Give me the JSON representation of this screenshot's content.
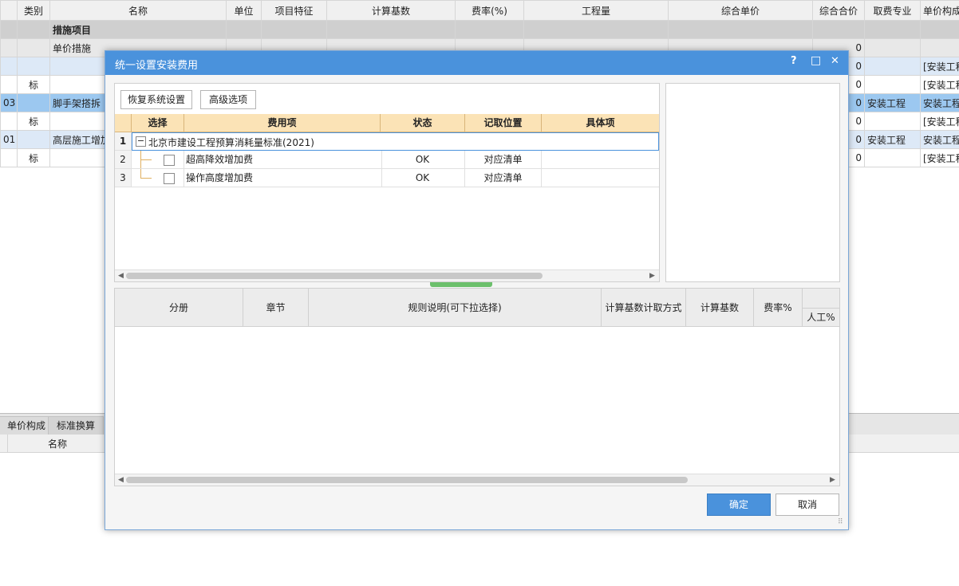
{
  "bg": {
    "headers": [
      "类别",
      "名称",
      "单位",
      "项目特征",
      "计算基数",
      "费率(%)",
      "工程量",
      "综合单价",
      "综合合价",
      "取费专业",
      "单价构成"
    ],
    "rows": [
      {
        "cls": "grp",
        "code": "",
        "type": "",
        "name": "措施项目",
        "total": "",
        "spec": "",
        "unit_comp": ""
      },
      {
        "cls": "sub",
        "code": "",
        "type": "",
        "name": "单价措施",
        "total": "0",
        "spec": "",
        "unit_comp": ""
      },
      {
        "cls": "lb",
        "code": "",
        "type": "",
        "name": "",
        "total": "0",
        "spec": "",
        "unit_comp": "[安装工程"
      },
      {
        "cls": "",
        "code": "",
        "type": "标",
        "name": "",
        "total": "0",
        "spec": "",
        "unit_comp": "[安装工程"
      },
      {
        "cls": "sel",
        "code": "03",
        "type": "",
        "name": "脚手架搭拆",
        "total": "0",
        "spec": "安装工程",
        "unit_comp": "安装工程"
      },
      {
        "cls": "",
        "code": "",
        "type": "标",
        "name": "",
        "total": "0",
        "spec": "",
        "unit_comp": "[安装工程"
      },
      {
        "cls": "lb",
        "code": "01",
        "type": "",
        "name": "高层施工增加",
        "total": "0",
        "spec": "安装工程",
        "unit_comp": "安装工程"
      },
      {
        "cls": "",
        "code": "",
        "type": "标",
        "name": "",
        "total": "0",
        "spec": "",
        "unit_comp": "[安装工程"
      }
    ],
    "bottom_tabs": [
      "单价构成",
      "标准换算"
    ],
    "bottom_header": "名称"
  },
  "dialog": {
    "title": "统一设置安装费用",
    "help": "?",
    "maximize": "□",
    "close": "✕",
    "restore_btn": "恢复系统设置",
    "advanced_btn": "高级选项",
    "grid_headers": [
      "选择",
      "费用项",
      "状态",
      "记取位置",
      "具体项"
    ],
    "group_row": {
      "num": "1",
      "label": "北京市建设工程预算消耗量标准(2021)",
      "toggle": "−"
    },
    "items": [
      {
        "num": "2",
        "label": "超高降效增加费",
        "status": "OK",
        "position": "对应清单",
        "detail": ""
      },
      {
        "num": "3",
        "label": "操作高度增加费",
        "status": "OK",
        "position": "对应清单",
        "detail": ""
      }
    ],
    "bottom_headers": [
      "分册",
      "章节",
      "规则说明(可下拉选择)",
      "计算基数计取方式",
      "计算基数",
      "费率%",
      "人工%"
    ],
    "ok": "确定",
    "cancel": "取消"
  },
  "colors": {
    "title_bar": "#4a92dc",
    "header_orange": "#fbe3b6",
    "primary_btn": "#4a92dc",
    "selected_row": "#9cc8f0"
  }
}
